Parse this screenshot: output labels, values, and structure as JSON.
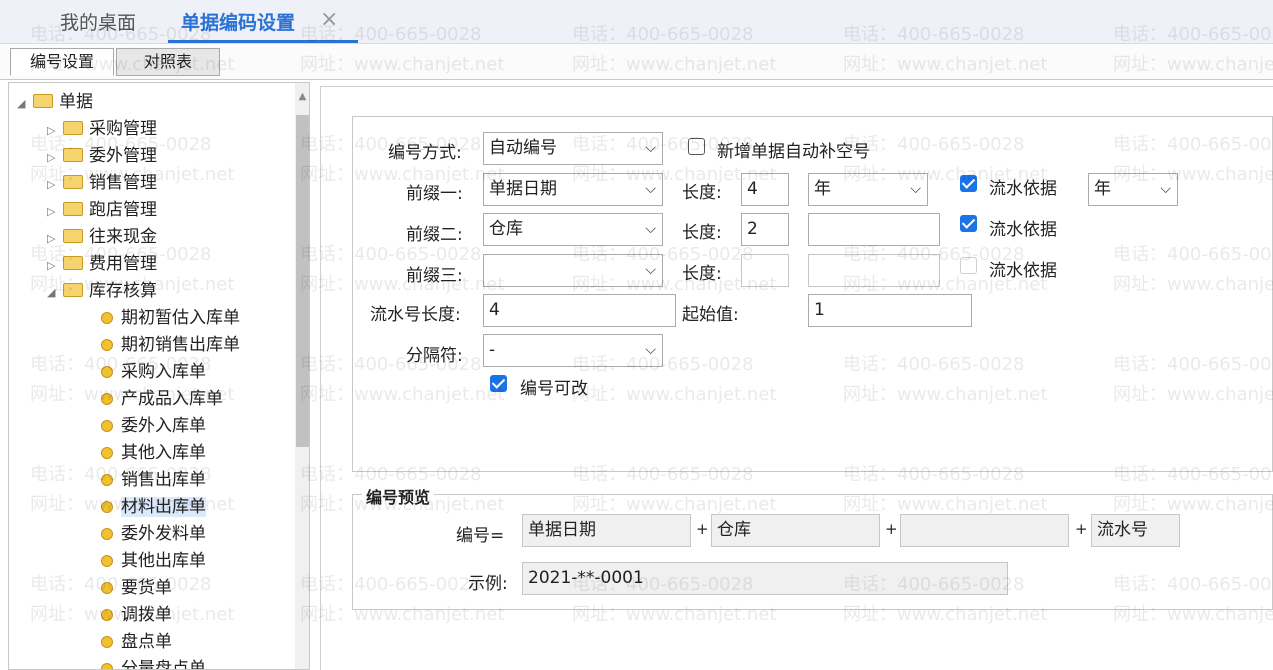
{
  "tabs": {
    "home": "我的桌面",
    "active": "单据编码设置",
    "close_icon": "×"
  },
  "subtabs": [
    "编号设置",
    "对照表"
  ],
  "tree": {
    "root": "单据",
    "folders": [
      "采购管理",
      "委外管理",
      "销售管理",
      "跑店管理",
      "往来现金",
      "费用管理"
    ],
    "expanded_folder": "库存核算",
    "items": [
      "期初暂估入库单",
      "期初销售出库单",
      "采购入库单",
      "产成品入库单",
      "委外入库单",
      "其他入库单",
      "销售出库单",
      "材料出库单",
      "委外发料单",
      "其他出库单",
      "要货单",
      "调拨单",
      "盘点单",
      "分量盘点单"
    ],
    "selected_item": "材料出库单"
  },
  "form": {
    "method_label": "编号方式:",
    "method_value": "自动编号",
    "auto_fill_label": "新增单据自动补空号",
    "auto_fill_checked": false,
    "prefix1_label": "前缀一:",
    "prefix1_value": "单据日期",
    "prefix1_length_label": "长度:",
    "prefix1_length": "4",
    "prefix1_format": "年",
    "prefix1_serial_label": "流水依据",
    "prefix1_serial_checked": true,
    "prefix1_serial_value": "年",
    "prefix2_label": "前缀二:",
    "prefix2_value": "仓库",
    "prefix2_length_label": "长度:",
    "prefix2_length": "2",
    "prefix2_format": "",
    "prefix2_serial_label": "流水依据",
    "prefix2_serial_checked": true,
    "prefix3_label": "前缀三:",
    "prefix3_value": "",
    "prefix3_length_label": "长度:",
    "prefix3_length": "",
    "prefix3_format": "",
    "prefix3_serial_label": "流水依据",
    "prefix3_serial_checked": false,
    "serial_length_label": "流水号长度:",
    "serial_length": "4",
    "start_label": "起始值:",
    "start_value": "1",
    "separator_label": "分隔符:",
    "separator_value": "-",
    "editable_label": "编号可改",
    "editable_checked": true
  },
  "preview": {
    "title": "编号预览",
    "number_label": "编号=",
    "part1": "单据日期",
    "part2": "仓库",
    "part3": "",
    "part4": "流水号",
    "plus": "+",
    "example_label": "示例:",
    "example_value": "2021-**-0001"
  },
  "watermark": {
    "phone": "电话：400-665-0028",
    "site": "网址：www.chanjet.net"
  },
  "dropdown_icon": "chevron-down-icon",
  "accent_color": "#2a72d4"
}
